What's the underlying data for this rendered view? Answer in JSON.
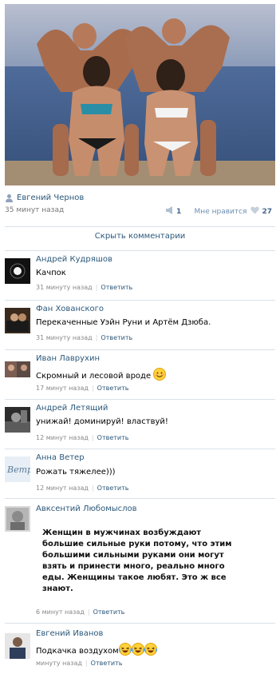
{
  "post": {
    "author": "Евгений Чернов",
    "time": "35 минут назад",
    "share_count": "1",
    "like_label": "Мне нравится",
    "like_count": "27",
    "hide_comments_label": "Скрыть комментарии"
  },
  "comments": [
    {
      "name": "Андрей Кудряшов",
      "text": "Качпок",
      "time": "31 минуту назад",
      "reply": "Ответить"
    },
    {
      "name": "Фан Хованского",
      "text": "Перекаченные Уэйн Руни и Артём Дзюба.",
      "time": "31 минуту назад",
      "reply": "Ответить"
    },
    {
      "name": "Иван Лаврухин",
      "text": "Скромный и лесовой вроде",
      "time": "17 минут назад",
      "reply": "Ответить"
    },
    {
      "name": "Андрей Летящий",
      "text": "унижай! доминируй! властвуй!",
      "time": "12 минут назад",
      "reply": "Ответить"
    },
    {
      "name": "Анна Ветер",
      "text": "Рожать тяжелее)))",
      "time": "12 минут назад",
      "reply": "Ответить"
    },
    {
      "name": "Авксентий Любомыслов",
      "text": "Женщин в мужчинах возбуждают большие сильные руки потому, что этим большими сильными руками они могут взять и принести много, реально много еды. Женщины такое любят. Это ж все знают.",
      "time": "6 минут назад",
      "reply": "Ответить"
    },
    {
      "name": "Евгений Иванов",
      "text": "Подкачка воздухом",
      "time": "минуту назад",
      "reply": "Ответить"
    }
  ],
  "icons": {
    "share": "megaphone-icon",
    "like": "heart-icon",
    "author": "user-icon",
    "emoji_smile": "smiley-emoji-icon",
    "emoji_laugh": "laughing-emoji-icon"
  },
  "colors": {
    "link": "#2b587a",
    "muted": "#888888",
    "divider": "#dae1e8"
  }
}
